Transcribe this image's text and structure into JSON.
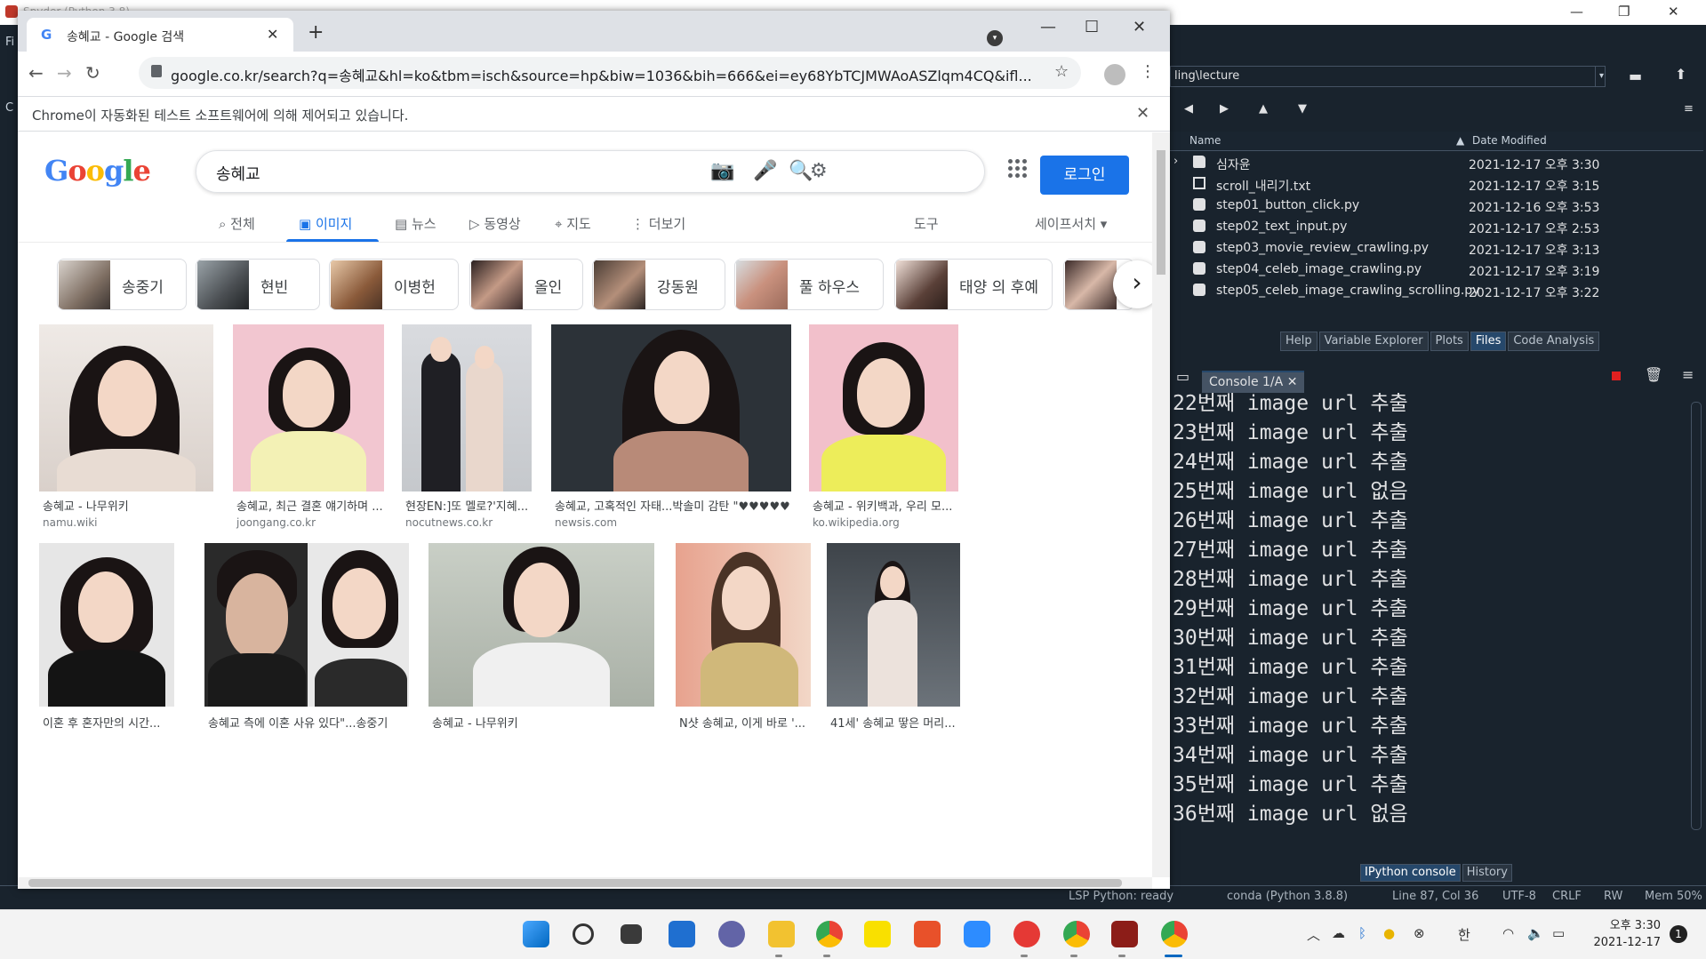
{
  "spyder": {
    "window_title": "Spyder (Python 3.8)",
    "left_labels": [
      "Fi",
      "C"
    ],
    "path": "ling\\lecture",
    "file_header": {
      "name": "Name",
      "date": "Date Modified"
    },
    "files": [
      {
        "name": "심자윤",
        "date": "2021-12-17 오후 3:30",
        "icon": "folder-icon"
      },
      {
        "name": "scroll_내리기.txt",
        "date": "2021-12-17 오후 3:15",
        "icon": "txt-file-icon"
      },
      {
        "name": "step01_button_click.py",
        "date": "2021-12-16 오후 3:53",
        "icon": "python-file-icon"
      },
      {
        "name": "step02_text_input.py",
        "date": "2021-12-17 오후 2:53",
        "icon": "python-file-icon"
      },
      {
        "name": "step03_movie_review_crawling.py",
        "date": "2021-12-17 오후 3:13",
        "icon": "python-file-icon"
      },
      {
        "name": "step04_celeb_image_crawling.py",
        "date": "2021-12-17 오후 3:19",
        "icon": "python-file-icon"
      },
      {
        "name": "step05_celeb_image_crawling_scrolling.py",
        "date": "2021-12-17 오후 3:22",
        "icon": "python-file-icon"
      }
    ],
    "upper_tabs": [
      "Help",
      "Variable Explorer",
      "Plots",
      "Files",
      "Code Analysis"
    ],
    "upper_active": "Files",
    "console_tab": "Console 1/A",
    "console_lines": [
      "22번째 image url 추출",
      "23번째 image url 추출",
      "24번째 image url 추출",
      "25번째 image url 없음",
      "26번째 image url 추출",
      "27번째 image url 추출",
      "28번째 image url 추출",
      "29번째 image url 추출",
      "30번째 image url 추출",
      "31번째 image url 추출",
      "32번째 image url 추출",
      "33번째 image url 추출",
      "34번째 image url 추출",
      "35번째 image url 추출",
      "36번째 image url 없음"
    ],
    "lower_tabs": [
      "IPython console",
      "History"
    ],
    "lower_active": "IPython console",
    "status": {
      "lsp": "LSP Python: ready",
      "env": "conda (Python 3.8.8)",
      "pos": "Line 87, Col 36",
      "enc": "UTF-8",
      "eol": "CRLF",
      "rw": "RW",
      "mem": "Mem 50%"
    }
  },
  "chrome": {
    "tab_title": "송혜교 - Google 검색",
    "tab_favicon": "G",
    "url": "google.co.kr/search?q=송혜교&hl=ko&tbm=isch&source=hp&biw=1036&bih=666&ei=ey68YbTCJMWAoASZlqm4CQ&ifl...",
    "infobar": "Chrome이 자동화된 테스트 소프트웨어에 의해 제어되고 있습니다."
  },
  "google": {
    "logo": "Google",
    "query": "송혜교",
    "login": "로그인",
    "tabs": [
      "전체",
      "이미지",
      "뉴스",
      "동영상",
      "지도",
      "더보기"
    ],
    "tools": "도구",
    "safesearch": "세이프서치 ▾",
    "chips": [
      "송중기",
      "현빈",
      "이병헌",
      "올인",
      "강동원",
      "풀 하우스",
      "태양 의 후예"
    ],
    "results_row1": [
      {
        "caption": "송혜교 - 나무위키",
        "source": "namu.wiki"
      },
      {
        "caption": "송혜교, 최근 결혼 얘기하며 ...",
        "source": "joongang.co.kr"
      },
      {
        "caption": "현장EN:]또 멜로?'지혜...",
        "source": "nocutnews.co.kr"
      },
      {
        "caption": "송혜교, 고혹적인 자태...박솔미 감탄 \"♥♥♥♥♥\" :...",
        "source": "newsis.com"
      },
      {
        "caption": "송혜교 - 위키백과, 우리 모...",
        "source": "ko.wikipedia.org"
      }
    ],
    "results_row2": [
      {
        "caption": "이혼 후 혼자만의 시간..."
      },
      {
        "caption": "송혜교 측에 이혼 사유 있다\"...송중기"
      },
      {
        "caption": "송혜교 - 나무위키"
      },
      {
        "caption": "N샷 송혜교, 이게 바로 '..."
      },
      {
        "caption": "41세' 송혜교 땋은 머리..."
      }
    ]
  },
  "taskbar": {
    "time": "오후 3:30",
    "date": "2021-12-17",
    "ime": "한",
    "notification_count": "1"
  }
}
